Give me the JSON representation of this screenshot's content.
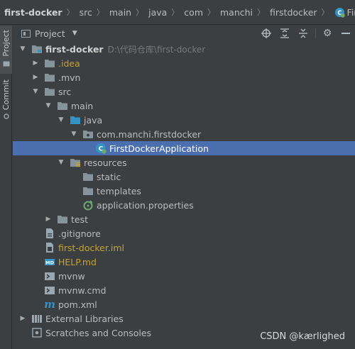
{
  "breadcrumb": {
    "items": [
      "first-docker",
      "src",
      "main",
      "java",
      "com",
      "manchi",
      "firstdocker",
      "FirstDockerApplication"
    ]
  },
  "side_tabs": {
    "project": "Project",
    "commit": "Commit"
  },
  "tool_window": {
    "title": "Project",
    "actions": [
      "locate-icon",
      "expand-all-icon",
      "collapse-all-icon",
      "gear-icon",
      "hide-icon"
    ]
  },
  "tree": {
    "root": {
      "name": "first-docker",
      "path": "D:\\代码仓库\\first-docker"
    },
    "idea": ".idea",
    "mvn": ".mvn",
    "src": "src",
    "main": "main",
    "java": "java",
    "package": "com.manchi.firstdocker",
    "app_class": "FirstDockerApplication",
    "resources": "resources",
    "static": "static",
    "templates": "templates",
    "app_props": "application.properties",
    "test": "test",
    "gitignore": ".gitignore",
    "iml": "first-docker.iml",
    "help": "HELP.md",
    "mvnw": "mvnw",
    "mvnw_cmd": "mvnw.cmd",
    "pom": "pom.xml",
    "ext_libs": "External Libraries",
    "scratches": "Scratches and Consoles"
  },
  "colors": {
    "selection": "#4b6eaf",
    "folder": "#87939a",
    "source_folder": "#3592c4",
    "ignored_text": "#c3a32b"
  },
  "watermark": "CSDN @kærlighed"
}
